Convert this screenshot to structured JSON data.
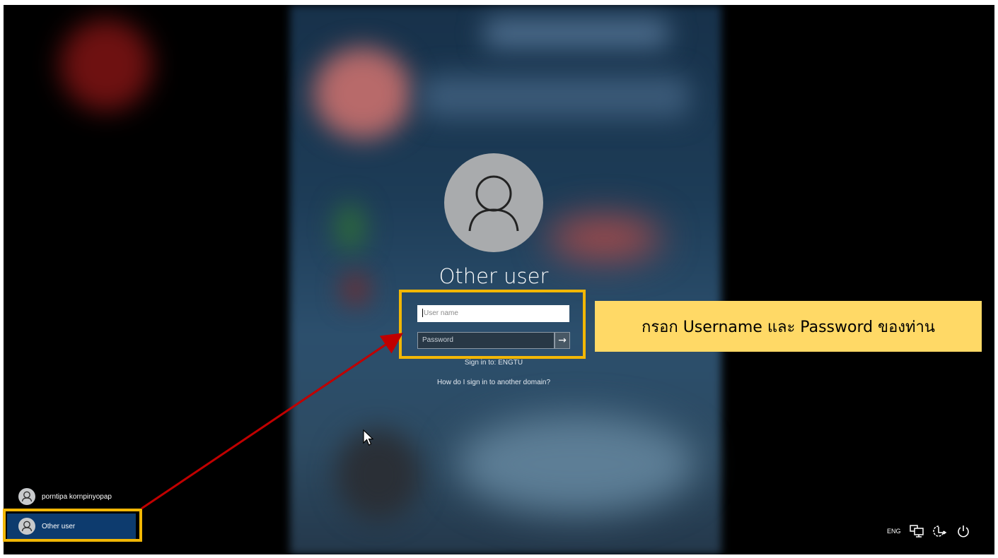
{
  "profile": {
    "name": "Other user",
    "icon": "user-icon"
  },
  "form": {
    "username_placeholder": "User name",
    "password_placeholder": "Password",
    "submit_glyph": "→",
    "sign_in_to": "Sign in to: ENGTU",
    "help_link": "How do I sign in to another domain?"
  },
  "annotation": {
    "callout_text": "กรอก Username และ Password ของท่าน",
    "highlight_color": "#f2b705",
    "callout_color": "#ffd966",
    "arrow_color": "#c00000"
  },
  "user_list": [
    {
      "name": "porntipa kornpinyopap",
      "selected": false
    },
    {
      "name": "Other user",
      "selected": true
    }
  ],
  "tray": {
    "language": "ENG",
    "icons": [
      "network-icon",
      "accessibility-icon",
      "power-icon"
    ]
  }
}
